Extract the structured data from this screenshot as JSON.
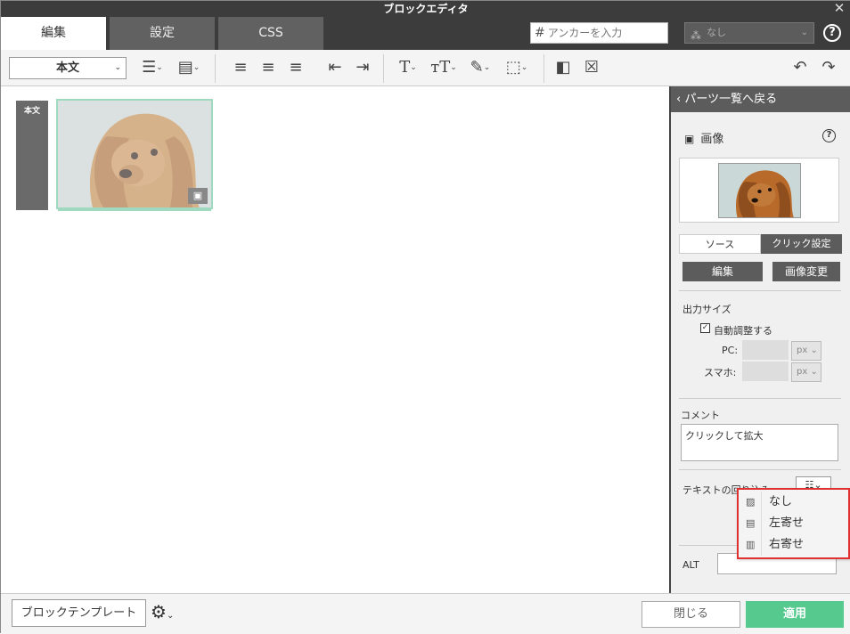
{
  "window": {
    "title": "ブロックエディタ"
  },
  "tabs": [
    {
      "label": "編集"
    },
    {
      "label": "設定"
    },
    {
      "label": "CSS"
    }
  ],
  "anchor": {
    "hash": "#",
    "placeholder": "アンカーを入力"
  },
  "class_select": {
    "value": "なし"
  },
  "toolbar": {
    "style_select": "本文"
  },
  "canvas": {
    "block_label": "本文"
  },
  "panel": {
    "back_label": "パーツ一覧へ戻る",
    "title": "画像",
    "subtabs": [
      {
        "label": "ソース"
      },
      {
        "label": "クリック設定"
      }
    ],
    "edit_button": "編集",
    "change_button": "画像変更",
    "output_size": {
      "label": "出力サイズ",
      "auto_label": "自動調整する",
      "auto_checked": true,
      "pc_label": "PC:",
      "sp_label": "スマホ:",
      "unit": "px"
    },
    "comment": {
      "label": "コメント",
      "value": "クリックして拡大"
    },
    "wrap": {
      "label": "テキストの回り込み"
    },
    "alt": {
      "label": "ALT",
      "value": ""
    }
  },
  "wrap_dropdown": {
    "items": [
      {
        "icon": "wrap-none-icon",
        "label": "なし"
      },
      {
        "icon": "wrap-left-icon",
        "label": "左寄せ"
      },
      {
        "icon": "wrap-right-icon",
        "label": "右寄せ"
      }
    ]
  },
  "footer": {
    "template_button": "ブロックテンプレート",
    "close_button": "閉じる",
    "apply_button": "適用"
  },
  "colors": {
    "accent": "#55c98e",
    "dark": "#3c3c3c",
    "highlight": "#e03030"
  }
}
